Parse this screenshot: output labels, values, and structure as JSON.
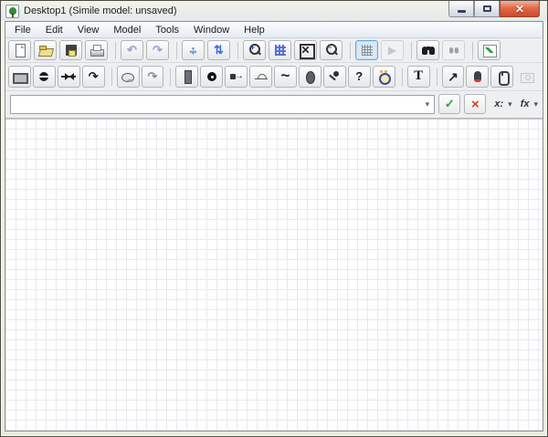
{
  "window": {
    "title": "Desktop1 (Simile model: unsaved)",
    "controls": {
      "minimize": "minimize",
      "maximize": "maximize",
      "close": "close"
    }
  },
  "menu_bar": {
    "items": [
      "File",
      "Edit",
      "View",
      "Model",
      "Tools",
      "Window",
      "Help"
    ]
  },
  "toolbar_main": {
    "buttons": [
      {
        "name": "new-file-button",
        "icon": "new-file"
      },
      {
        "name": "open-button",
        "icon": "open-folder"
      },
      {
        "name": "save-button",
        "icon": "save-floppy"
      },
      {
        "name": "print-button",
        "icon": "printer"
      },
      {
        "divider": true
      },
      {
        "name": "undo-button",
        "icon": "undo-arrow",
        "glyph": "↶"
      },
      {
        "name": "redo-button",
        "icon": "redo-arrow",
        "glyph": "↷"
      },
      {
        "divider": true
      },
      {
        "name": "pan-button",
        "icon": "move-arrows"
      },
      {
        "name": "expand-vertical-button",
        "icon": "vertical-arrows",
        "glyph": "⇅"
      },
      {
        "divider": true
      },
      {
        "name": "zoom-in-button",
        "icon": "zoom-in",
        "glyph": "+"
      },
      {
        "name": "zoom-normal-button",
        "icon": "pixel-pattern"
      },
      {
        "name": "zoom-fit-button",
        "icon": "fit-window"
      },
      {
        "name": "zoom-out-button",
        "icon": "zoom-out",
        "glyph": "−"
      },
      {
        "divider": true
      },
      {
        "name": "grid-toggle-button",
        "icon": "grid",
        "active": true
      },
      {
        "name": "run-model-button",
        "icon": "play",
        "glyph": "▶",
        "disabled": true
      },
      {
        "divider": true
      },
      {
        "name": "find-button",
        "icon": "binoculars"
      },
      {
        "name": "find-next-button",
        "icon": "binoculars-small",
        "disabled": true
      },
      {
        "divider": true
      },
      {
        "name": "export-image-button",
        "icon": "chart-image"
      }
    ]
  },
  "toolbar_model": {
    "buttons": [
      {
        "name": "compartment-tool-button",
        "icon": "compartment"
      },
      {
        "name": "sphere-tool-button",
        "icon": "sphere"
      },
      {
        "name": "flow-tool-button",
        "icon": "flow-valve"
      },
      {
        "name": "influence-arrow-tool-button",
        "icon": "influence-arrow",
        "glyph": "↷"
      },
      {
        "divider": true
      },
      {
        "name": "cloud-tool-button",
        "icon": "cloud"
      },
      {
        "name": "role-arrow-tool-button",
        "icon": "role-arrow",
        "glyph": "↷"
      },
      {
        "divider": true
      },
      {
        "name": "column-tool-button",
        "icon": "column"
      },
      {
        "name": "variable-tool-button",
        "icon": "variable-dot"
      },
      {
        "name": "channel-tool-button",
        "icon": "channel"
      },
      {
        "name": "sun-tool-button",
        "icon": "sun"
      },
      {
        "name": "sketch-graph-tool-button",
        "icon": "squiggle",
        "glyph": "~"
      },
      {
        "name": "egg-tool-button",
        "icon": "egg"
      },
      {
        "name": "pin-tool-button",
        "icon": "pin"
      },
      {
        "name": "help-tool-button",
        "icon": "question",
        "glyph": "?"
      },
      {
        "name": "alarm-tool-button",
        "icon": "alarm-clock"
      },
      {
        "divider": true
      },
      {
        "name": "text-tool-button",
        "icon": "text",
        "glyph": "T"
      },
      {
        "divider": true
      },
      {
        "name": "pointer-tool-button",
        "icon": "pointer-arrow",
        "glyph": "↗"
      },
      {
        "name": "mouse-tool-button",
        "icon": "mouse"
      },
      {
        "name": "mouse-outline-tool-button",
        "icon": "mouse-outline"
      },
      {
        "name": "snapshot-button",
        "icon": "camera",
        "disabled": true,
        "flat": true
      }
    ]
  },
  "equation_bar": {
    "value": "",
    "dropdown_glyph": "▾",
    "accept_glyph": "✓",
    "cancel_glyph": "×",
    "variables_label": "x:",
    "functions_label": "fx"
  },
  "canvas": {
    "grid_visible": true,
    "background": "#ffffff",
    "grid_color": "#e9e9ed",
    "grid_size_px": 11
  },
  "colors": {
    "accent_blue": "#3a6fd8",
    "active_button_border": "#66a7dd",
    "close_button_red": "#d9593c",
    "accept_green": "#2e9e3e",
    "cancel_red": "#d43c2a"
  }
}
